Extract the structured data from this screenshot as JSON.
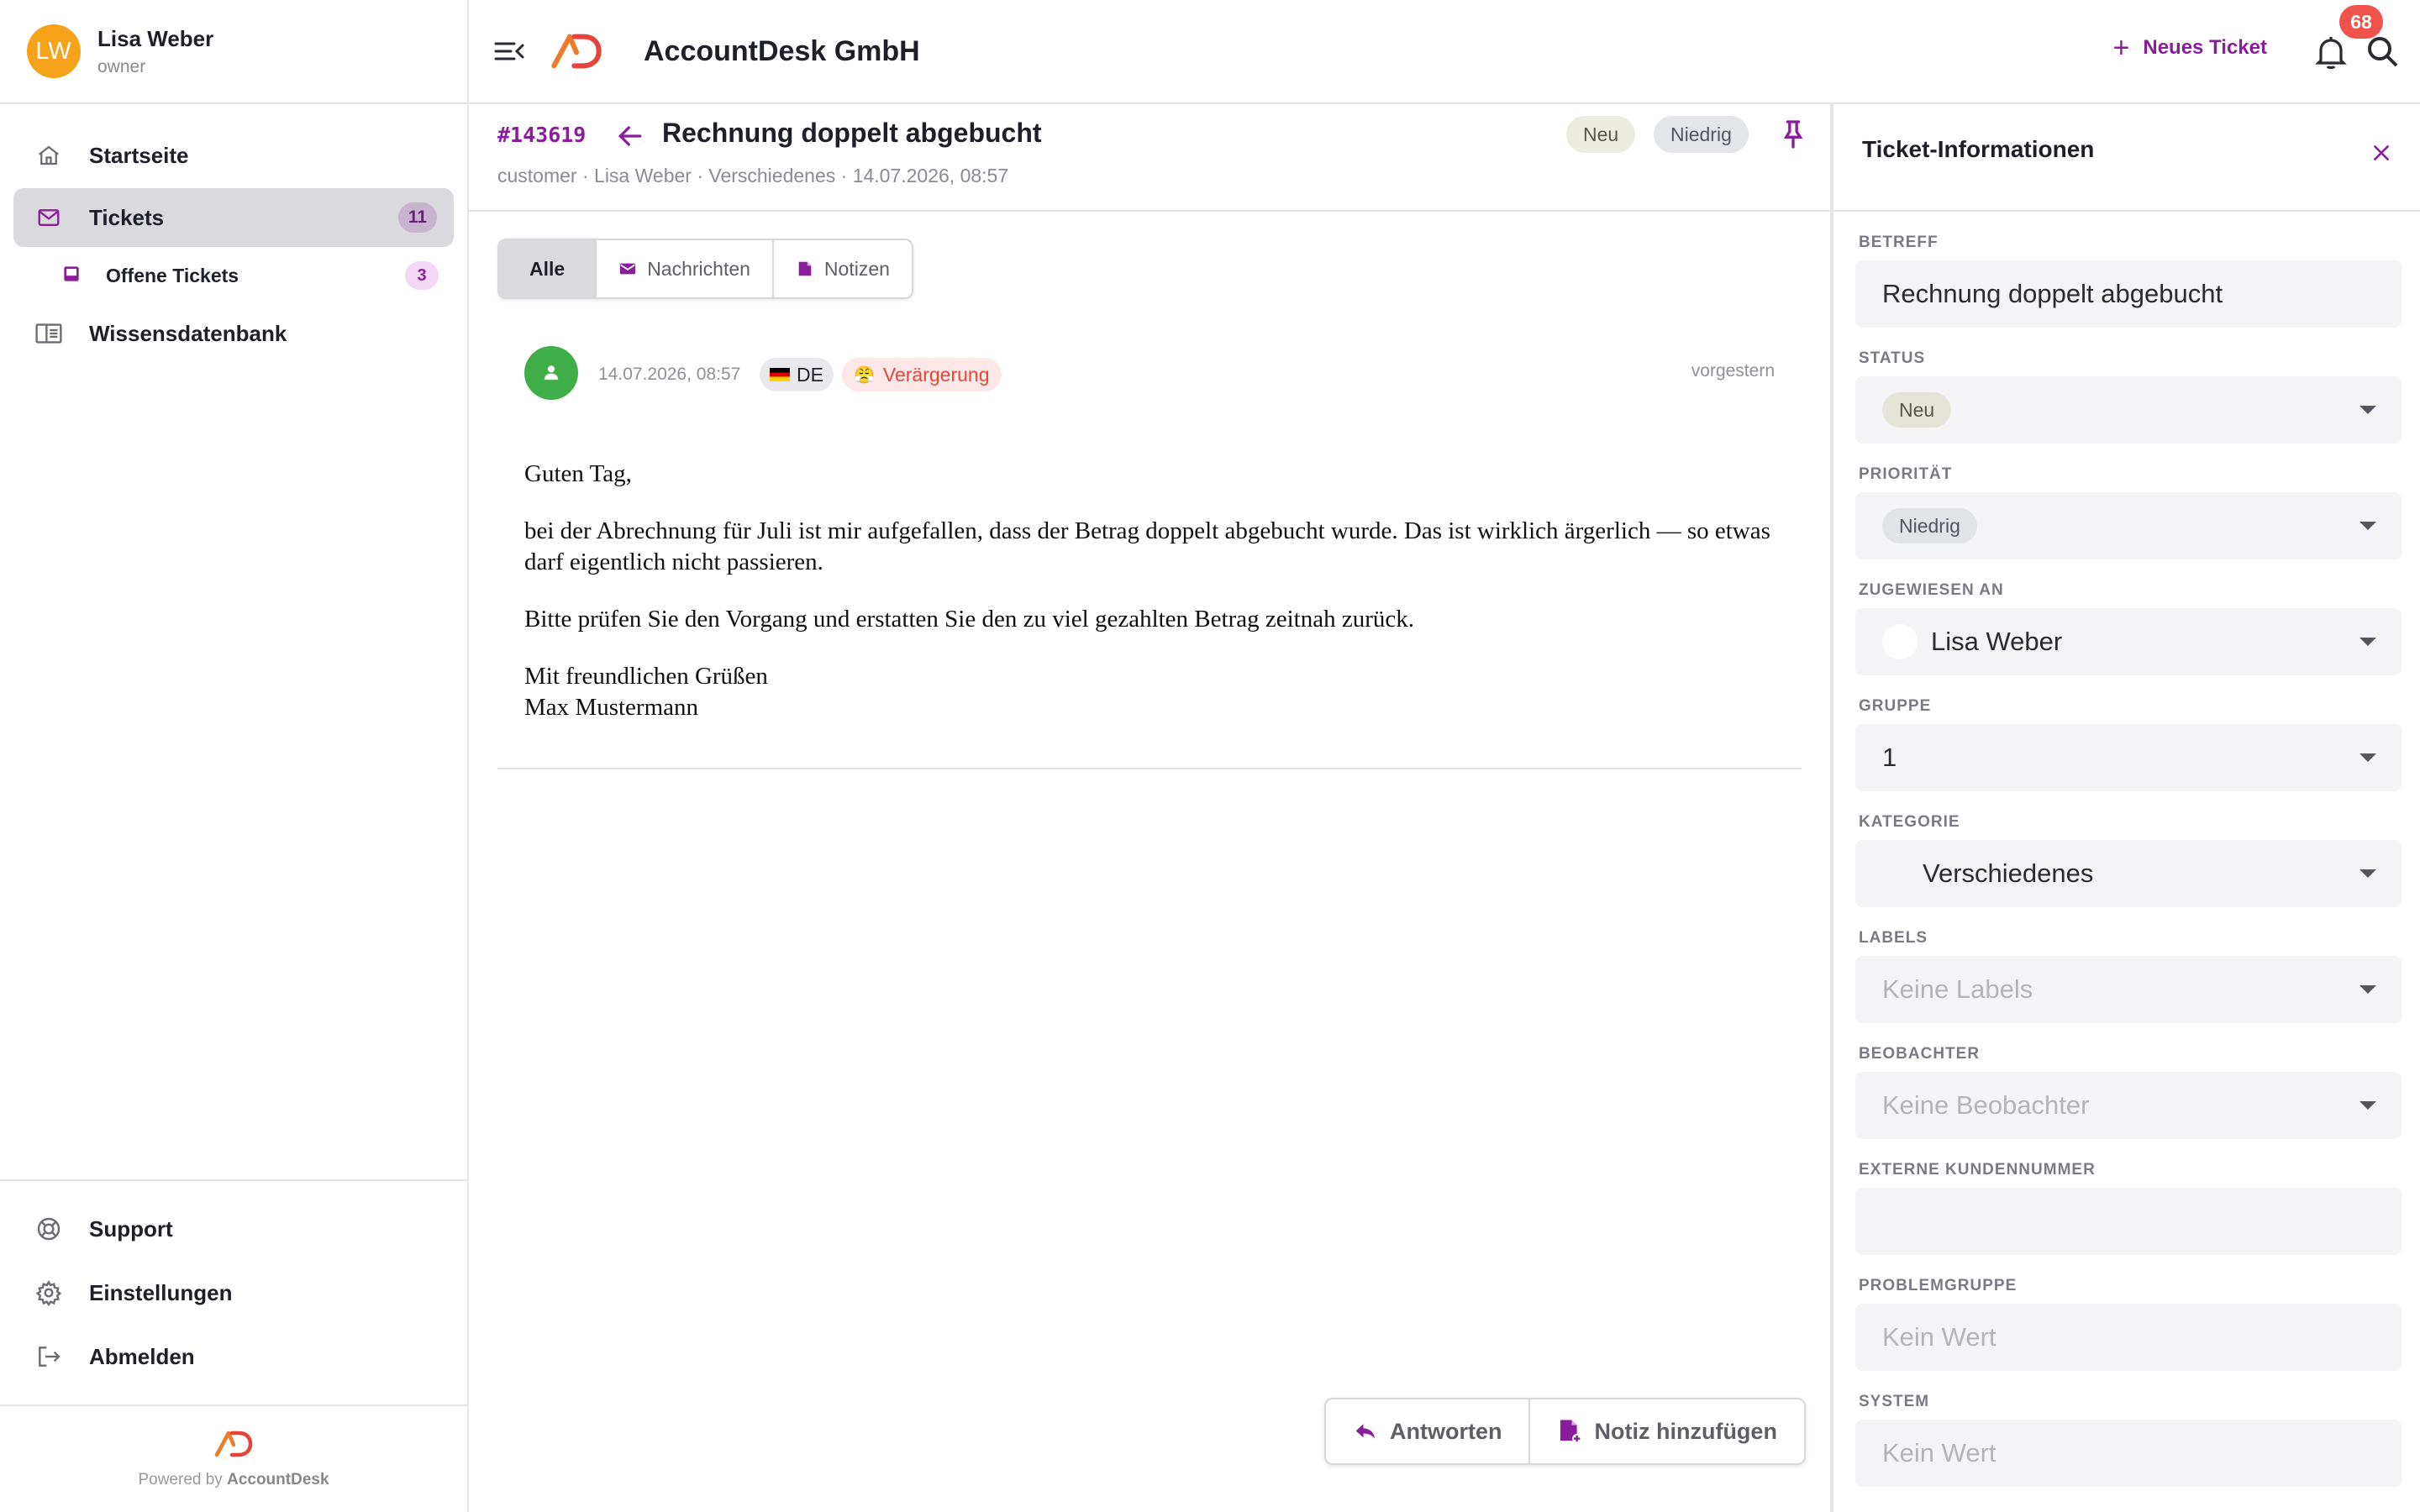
{
  "user": {
    "initials": "LW",
    "name": "Lisa Weber",
    "role": "owner"
  },
  "colors": {
    "accent": "#8a1d9c",
    "avatar": "#f7a21b",
    "badge": "#f0534b",
    "brand_orange": "#f07a2b",
    "brand_red": "#e4443a"
  },
  "sidebar": {
    "items": [
      {
        "label": "Startseite",
        "icon": "home-icon"
      },
      {
        "label": "Tickets",
        "icon": "mail-icon",
        "count": "11",
        "active": true
      },
      {
        "label": "Offene Tickets",
        "icon": "inbox-icon",
        "count": "3",
        "sub": true
      },
      {
        "label": "Wissensdatenbank",
        "icon": "book-icon"
      }
    ],
    "bottom": [
      {
        "label": "Support",
        "icon": "lifebuoy-icon"
      },
      {
        "label": "Einstellungen",
        "icon": "gear-icon"
      },
      {
        "label": "Abmelden",
        "icon": "logout-icon"
      }
    ],
    "footer": {
      "powered_prefix": "Powered by",
      "powered_brand": "AccountDesk"
    }
  },
  "topbar": {
    "company": "AccountDesk GmbH",
    "new_ticket_label": "Neues Ticket",
    "notification_count": "68"
  },
  "ticket": {
    "id": "#143619",
    "title": "Rechnung doppelt abgebucht",
    "meta": "customer · Lisa Weber · Verschiedenes · 14.07.2026, 08:57",
    "status": "Neu",
    "priority": "Niedrig"
  },
  "tabs": [
    {
      "label": "Alle",
      "active": true
    },
    {
      "label": "Nachrichten",
      "icon": "mail-icon"
    },
    {
      "label": "Notizen",
      "icon": "note-icon"
    }
  ],
  "message": {
    "date": "14.07.2026, 08:57",
    "language": "DE",
    "sentiment_emoji": "😤",
    "sentiment": "Verärgerung",
    "relative_time": "vorgestern",
    "paragraphs": [
      "Guten Tag,",
      "bei der Abrechnung für Juli ist mir aufgefallen, dass der Betrag doppelt abgebucht wurde. Das ist wirklich ärgerlich — so etwas darf eigentlich nicht passieren.",
      "Bitte prüfen Sie den Vorgang und erstatten Sie den zu viel gezahlten Betrag zeitnah zurück.",
      "Mit freundlichen Grüßen\nMax Mustermann"
    ]
  },
  "actions": {
    "reply": "Antworten",
    "add_note": "Notiz hinzufügen"
  },
  "panel": {
    "title": "Ticket-Informationen",
    "fields": [
      {
        "label": "BETREFF",
        "value": "Rechnung doppelt abgebucht"
      },
      {
        "label": "STATUS",
        "value": "Neu"
      },
      {
        "label": "PRIORITÄT",
        "value": "Niedrig"
      },
      {
        "label": "ZUGEWIESEN AN",
        "value": "Lisa Weber"
      },
      {
        "label": "GRUPPE",
        "value": "1"
      },
      {
        "label": "KATEGORIE",
        "value": "Verschiedenes"
      },
      {
        "label": "LABELS",
        "placeholder": "Keine Labels"
      },
      {
        "label": "BEOBACHTER",
        "placeholder": "Keine Beobachter"
      },
      {
        "label": "EXTERNE KUNDENNUMMER",
        "value": ""
      },
      {
        "label": "PROBLEMGRUPPE",
        "placeholder": "Kein Wert"
      },
      {
        "label": "SYSTEM",
        "placeholder": "Kein Wert"
      }
    ]
  }
}
